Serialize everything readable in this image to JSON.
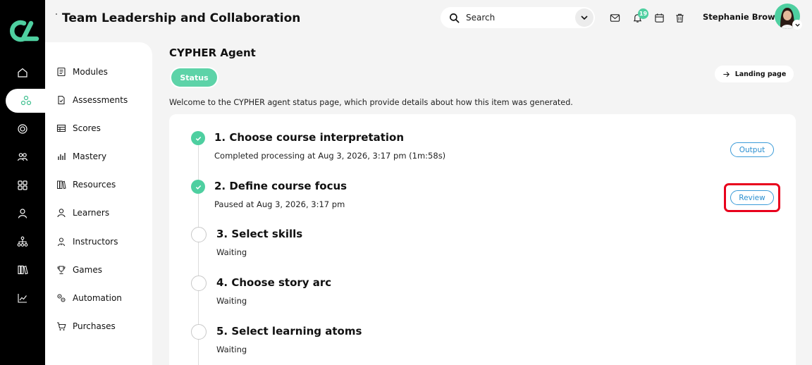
{
  "header": {
    "title": "Team Leadership and Collaboration",
    "search_placeholder": "Search",
    "notification_count": "19",
    "user_name": "Stephanie Brown"
  },
  "rail": {
    "icons": [
      "home-icon",
      "network-icon",
      "target-icon",
      "users-icon",
      "grid-icon",
      "user-icon",
      "hierarchy-icon",
      "library-icon",
      "chart-icon"
    ],
    "active": "network-icon"
  },
  "sidebar": {
    "items": [
      {
        "label": "Modules",
        "icon": "modules-icon"
      },
      {
        "label": "Assessments",
        "icon": "assessment-icon"
      },
      {
        "label": "Scores",
        "icon": "scores-icon"
      },
      {
        "label": "Mastery",
        "icon": "mastery-icon"
      },
      {
        "label": "Resources",
        "icon": "resources-icon"
      },
      {
        "label": "Learners",
        "icon": "learner-icon"
      },
      {
        "label": "Instructors",
        "icon": "instructor-icon"
      },
      {
        "label": "Games",
        "icon": "trophy-icon"
      },
      {
        "label": "Automation",
        "icon": "automation-icon"
      },
      {
        "label": "Purchases",
        "icon": "cart-icon"
      }
    ]
  },
  "main": {
    "page_title": "CYPHER Agent",
    "status_tab": "Status",
    "landing_button": "Landing page",
    "intro": "Welcome to the CYPHER agent status page, which provide details about how this item was generated.",
    "steps": [
      {
        "title": "1. Choose course interpretation",
        "subtitle": "Completed processing at Aug 3, 2026, 3:17 pm (1m:58s)",
        "state": "done",
        "action": "Output"
      },
      {
        "title": "2. Define course focus",
        "subtitle": "Paused at Aug 3, 2026, 3:17 pm",
        "state": "done",
        "action": "Review"
      },
      {
        "title": "3. Select skills",
        "subtitle": "Waiting",
        "state": "waiting"
      },
      {
        "title": "4. Choose story arc",
        "subtitle": "Waiting",
        "state": "waiting"
      },
      {
        "title": "5. Select learning atoms",
        "subtitle": "Waiting",
        "state": "waiting"
      }
    ]
  },
  "colors": {
    "accent": "#4ecfa0",
    "link": "#2b8fd0",
    "highlight": "#e8001c",
    "rail": "#000000"
  }
}
